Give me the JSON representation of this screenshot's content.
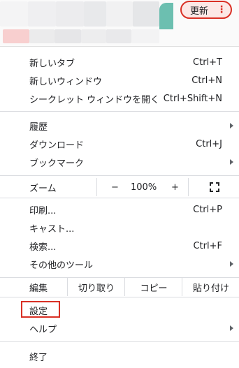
{
  "browser_bar": {
    "update_label": "更新",
    "menu_dots": "⋮",
    "colors": {
      "update_border": "#d93025",
      "update_bg": "#fce8e6",
      "teal": "#6cbfb0",
      "pink": "#f8cfcf"
    }
  },
  "menu": {
    "new_tab": {
      "label": "新しいタブ",
      "shortcut": "Ctrl+T"
    },
    "new_window": {
      "label": "新しいウィンドウ",
      "shortcut": "Ctrl+N"
    },
    "incognito": {
      "label": "シークレット ウィンドウを開く",
      "shortcut": "Ctrl+Shift+N"
    },
    "history": {
      "label": "履歴"
    },
    "downloads": {
      "label": "ダウンロード",
      "shortcut": "Ctrl+J"
    },
    "bookmarks": {
      "label": "ブックマーク"
    },
    "zoom": {
      "label": "ズーム",
      "minus": "−",
      "level": "100%",
      "plus": "+"
    },
    "print": {
      "label": "印刷...",
      "shortcut": "Ctrl+P"
    },
    "cast": {
      "label": "キャスト..."
    },
    "find": {
      "label": "検索...",
      "shortcut": "Ctrl+F"
    },
    "more_tools": {
      "label": "その他のツール"
    },
    "edit": {
      "label": "編集",
      "cut": "切り取り",
      "copy": "コピー",
      "paste": "貼り付け"
    },
    "settings": {
      "label": "設定"
    },
    "help": {
      "label": "ヘルプ"
    },
    "exit": {
      "label": "終了"
    }
  }
}
